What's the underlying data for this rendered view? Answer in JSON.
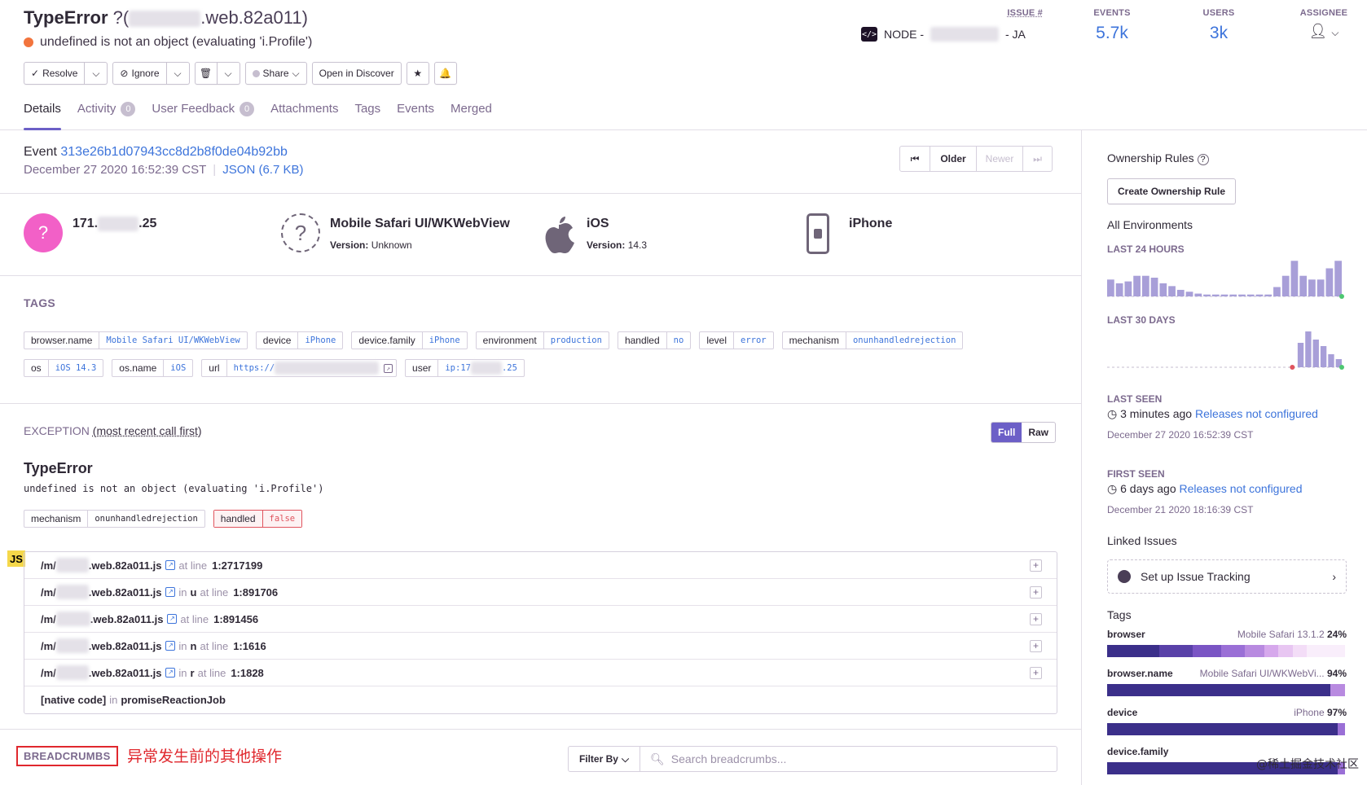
{
  "header": {
    "title_error": "TypeError",
    "title_prefix": "?(",
    "title_suffix": ".web.82a011)",
    "message": "undefined is not an object (evaluating 'i.Profile')",
    "buttons": {
      "resolve": "Resolve",
      "ignore": "Ignore",
      "share": "Share",
      "open_in_discover": "Open in Discover"
    },
    "tabs": [
      {
        "label": "Details",
        "count": null
      },
      {
        "label": "Activity",
        "count": "0"
      },
      {
        "label": "User Feedback",
        "count": "0"
      },
      {
        "label": "Attachments",
        "count": null
      },
      {
        "label": "Tags",
        "count": null
      },
      {
        "label": "Events",
        "count": null
      },
      {
        "label": "Merged",
        "count": null
      }
    ],
    "project": {
      "prefix": "NODE -",
      "suffix": "- JA"
    },
    "stats": {
      "issue_label": "ISSUE #",
      "events_label": "EVENTS",
      "events_value": "5.7k",
      "users_label": "USERS",
      "users_value": "3k",
      "assignee_label": "ASSIGNEE"
    }
  },
  "event": {
    "label": "Event",
    "id": "313e26b1d07943cc8d2b8f0de04b92bb",
    "date": "December 27 2020 16:52:39 CST",
    "json_link": "JSON (6.7 KB)",
    "pager": {
      "older": "Older",
      "newer": "Newer"
    }
  },
  "context": {
    "ip_prefix": "171.",
    "ip_suffix": ".25",
    "browser": {
      "title": "Mobile Safari UI/WKWebView",
      "version_label": "Version:",
      "version": "Unknown"
    },
    "os": {
      "title": "iOS",
      "version_label": "Version:",
      "version": "14.3"
    },
    "device": {
      "title": "iPhone"
    }
  },
  "tags_section": {
    "heading": "TAGS",
    "row1": [
      {
        "key": "browser.name",
        "value": "Mobile Safari UI/WKWebView"
      },
      {
        "key": "device",
        "value": "iPhone"
      },
      {
        "key": "device.family",
        "value": "iPhone"
      },
      {
        "key": "environment",
        "value": "production"
      },
      {
        "key": "handled",
        "value": "no"
      },
      {
        "key": "level",
        "value": "error"
      },
      {
        "key": "mechanism",
        "value": "onunhandledrejection"
      }
    ],
    "row2": [
      {
        "key": "os",
        "value": "iOS 14.3"
      },
      {
        "key": "os.name",
        "value": "iOS"
      },
      {
        "key": "url",
        "value": "https://"
      },
      {
        "key": "user",
        "value_prefix": "ip:17",
        "value_suffix": ".25"
      }
    ]
  },
  "exception": {
    "heading": "EXCEPTION",
    "heading_note": "(most recent call first)",
    "toggle": {
      "full": "Full",
      "raw": "Raw"
    },
    "type": "TypeError",
    "value": "undefined is not an object (evaluating 'i.Profile')",
    "mechanism_tags": [
      {
        "key": "mechanism",
        "value": "onunhandledrejection"
      },
      {
        "key": "handled",
        "value": "false"
      }
    ],
    "platform_badge": "JS",
    "frames": [
      {
        "path_prefix": "/m/",
        "file": ".web.82a011.js",
        "fn": "",
        "at_line": "at line",
        "line": "1:2717199"
      },
      {
        "path_prefix": "/m/",
        "file": ".web.82a011.js",
        "in": "in",
        "fn": "u",
        "at_line": "at line",
        "line": "1:891706"
      },
      {
        "path_prefix": "/m/",
        "file": ".web.82a011.js",
        "fn": "",
        "at_line": "at line",
        "line": "1:891456"
      },
      {
        "path_prefix": "/m/",
        "file": ".web.82a011.js",
        "in": "in",
        "fn": "n",
        "at_line": "at line",
        "line": "1:1616"
      },
      {
        "path_prefix": "/m/",
        "file": ".web.82a011.js",
        "in": "in",
        "fn": "r",
        "at_line": "at line",
        "line": "1:1828"
      }
    ],
    "native_frame": {
      "label": "[native code]",
      "in": "in",
      "fn": "promiseReactionJob"
    }
  },
  "breadcrumbs": {
    "heading": "BREADCRUMBS",
    "annotation": "异常发生前的其他操作",
    "filter": "Filter By",
    "search_placeholder": "Search breadcrumbs..."
  },
  "sidebar": {
    "ownership_title": "Ownership Rules",
    "create_rule_button": "Create Ownership Rule",
    "all_environments": "All Environments",
    "last_24h": "LAST 24 HOURS",
    "last_30d": "LAST 30 DAYS",
    "last_seen": {
      "label": "LAST SEEN",
      "ago": "3 minutes ago",
      "release": "Releases not configured",
      "date": "December 27 2020 16:52:39 CST"
    },
    "first_seen": {
      "label": "FIRST SEEN",
      "ago": "6 days ago",
      "release": "Releases not configured",
      "date": "December 21 2020 18:16:39 CST"
    },
    "linked_issues": "Linked Issues",
    "issue_tracking": "Set up Issue Tracking",
    "tags_title": "Tags",
    "tag_bars": [
      {
        "name": "browser",
        "top": "Mobile Safari 13.1.2",
        "pct": "24%"
      },
      {
        "name": "browser.name",
        "top": "Mobile Safari UI/WKWebVi...",
        "pct": "94%"
      },
      {
        "name": "device",
        "top": "iPhone",
        "pct": "97%"
      },
      {
        "name": "device.family",
        "top": "",
        "pct": ""
      }
    ],
    "watermark": "@稀土掘金技术社区"
  },
  "colors": {
    "accent": "#6c5fc7",
    "link": "#3d74db",
    "error": "#e0545e",
    "bar_dark": "#3b2f8a"
  },
  "charts": {
    "last_24h_values": [
      18,
      14,
      16,
      22,
      22,
      20,
      14,
      11,
      7,
      5,
      3,
      2,
      2,
      2,
      2,
      2,
      2,
      2,
      2,
      10,
      22,
      38,
      22,
      18,
      18,
      30,
      38
    ],
    "last_30d_values": [
      0,
      0,
      0,
      0,
      0,
      0,
      0,
      0,
      0,
      0,
      0,
      0,
      0,
      0,
      0,
      0,
      0,
      0,
      0,
      0,
      0,
      0,
      0,
      0,
      0,
      30,
      44,
      34,
      26,
      16,
      10
    ]
  }
}
